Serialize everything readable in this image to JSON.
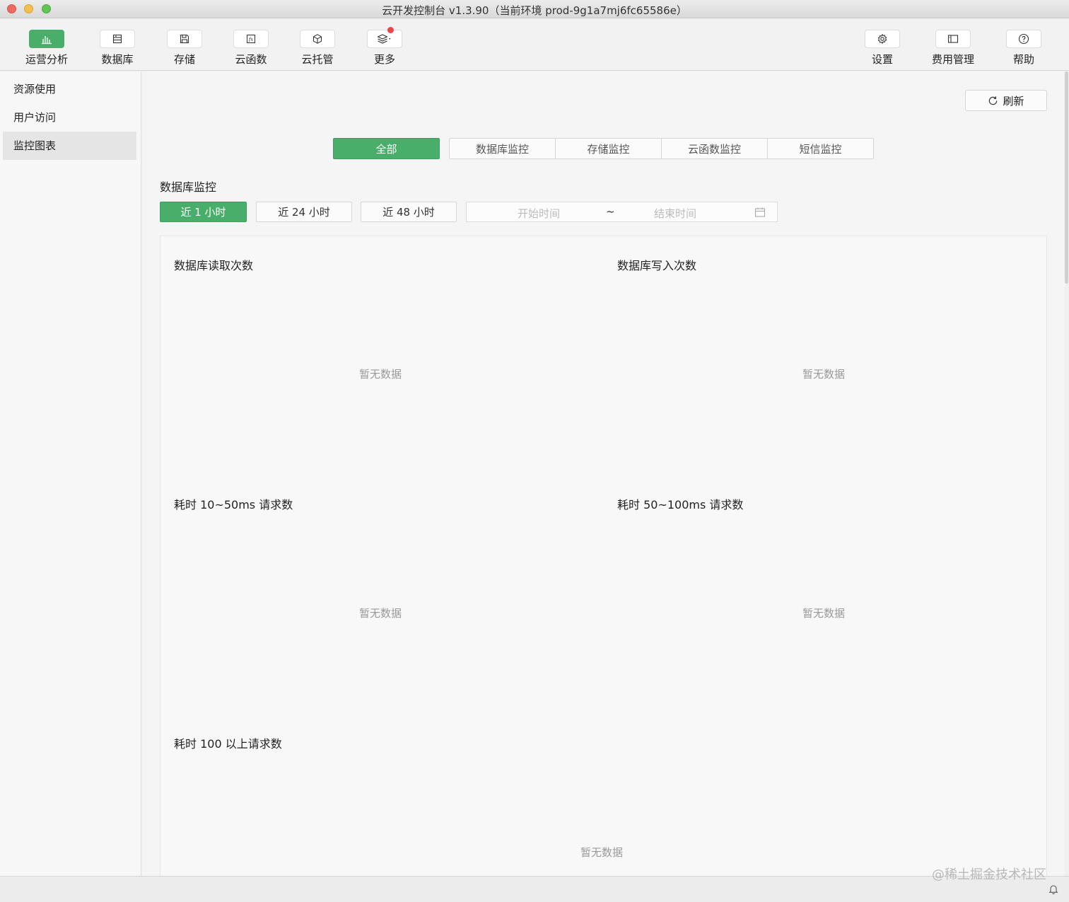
{
  "window": {
    "title": "云开发控制台 v1.3.90（当前环境 prod-9g1a7mj6fc65586e）"
  },
  "toolbar": {
    "items": [
      {
        "label": "运营分析",
        "icon": "bar-chart-icon",
        "active": true
      },
      {
        "label": "数据库",
        "icon": "database-icon"
      },
      {
        "label": "存储",
        "icon": "floppy-disk-icon"
      },
      {
        "label": "云函数",
        "icon": "function-icon"
      },
      {
        "label": "云托管",
        "icon": "cube-icon"
      },
      {
        "label": "更多",
        "icon": "layers-icon"
      }
    ],
    "right": [
      {
        "label": "设置",
        "icon": "gear-icon"
      },
      {
        "label": "费用管理",
        "icon": "wallet-icon"
      },
      {
        "label": "帮助",
        "icon": "help-icon"
      }
    ]
  },
  "sidebar": {
    "items": [
      {
        "label": "资源使用"
      },
      {
        "label": "用户访问"
      },
      {
        "label": "监控图表",
        "active": true
      }
    ]
  },
  "main": {
    "refresh_label": "刷新",
    "segments": [
      "全部",
      "数据库监控",
      "存储监控",
      "云函数监控",
      "短信监控"
    ],
    "section_title": "数据库监控",
    "ranges": [
      "近 1 小时",
      "近 24 小时",
      "近 48 小时"
    ],
    "date": {
      "start_placeholder": "开始时间",
      "separator": "~",
      "end_placeholder": "结束时间"
    },
    "charts": [
      {
        "title": "数据库读取次数",
        "empty": "暂无数据"
      },
      {
        "title": "数据库写入次数",
        "empty": "暂无数据"
      },
      {
        "title": "耗时 10~50ms 请求数",
        "empty": "暂无数据"
      },
      {
        "title": "耗时 50~100ms 请求数",
        "empty": "暂无数据"
      },
      {
        "title": "耗时 100 以上请求数",
        "empty": "暂无数据"
      }
    ]
  },
  "status": {
    "watermark": "@稀土掘金技术社区"
  },
  "colors": {
    "accent": "#48ae6a",
    "notification_dot": "#e8464d"
  }
}
